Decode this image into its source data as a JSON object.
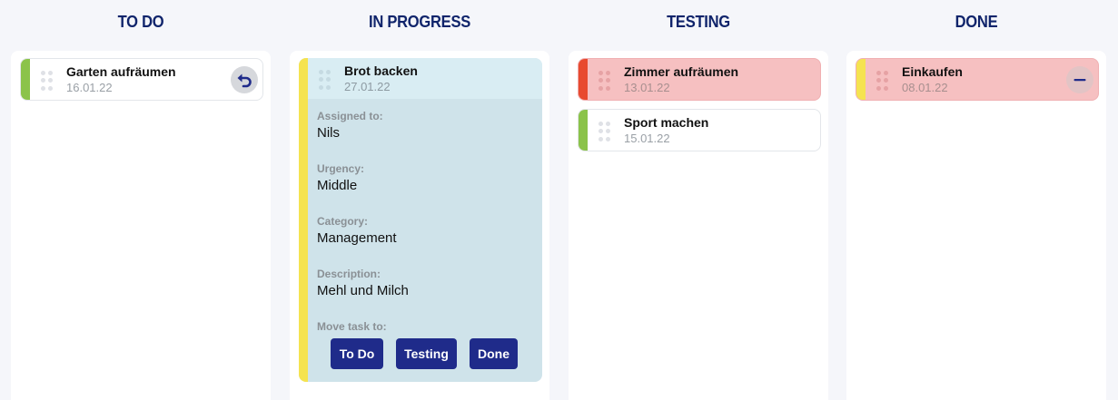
{
  "colors": {
    "accent": "#1f2b8a",
    "title": "#10246b",
    "green": "#8bc34a",
    "yellow": "#f5e350",
    "red": "#e84a2f",
    "card_red_bg": "#f6c0c1",
    "expanded_bg": "#cfe3ea"
  },
  "columns": [
    {
      "title": "TO DO",
      "cards": [
        {
          "title": "Garten aufräumen",
          "date": "16.01.22",
          "color": "#8bc34a",
          "action_icon": "undo-icon"
        }
      ]
    },
    {
      "title": "IN PROGRESS",
      "expanded_card": {
        "title": "Brot backen",
        "date": "27.01.22",
        "color": "#f5e350",
        "fields": [
          {
            "label": "Assigned to:",
            "value": "Nils"
          },
          {
            "label": "Urgency:",
            "value": "Middle"
          },
          {
            "label": "Category:",
            "value": "Management"
          },
          {
            "label": "Description:",
            "value": "Mehl und Milch"
          }
        ],
        "move_label": "Move task to:",
        "move_buttons": [
          "To Do",
          "Testing",
          "Done"
        ]
      }
    },
    {
      "title": "TESTING",
      "cards": [
        {
          "title": "Zimmer aufräumen",
          "date": "13.01.22",
          "color": "#e84a2f",
          "highlighted": true
        },
        {
          "title": "Sport machen",
          "date": "15.01.22",
          "color": "#8bc34a"
        }
      ]
    },
    {
      "title": "DONE",
      "cards": [
        {
          "title": "Einkaufen",
          "date": "08.01.22",
          "color": "#f5e350",
          "highlighted": true,
          "action_icon": "minus-icon"
        }
      ]
    }
  ]
}
